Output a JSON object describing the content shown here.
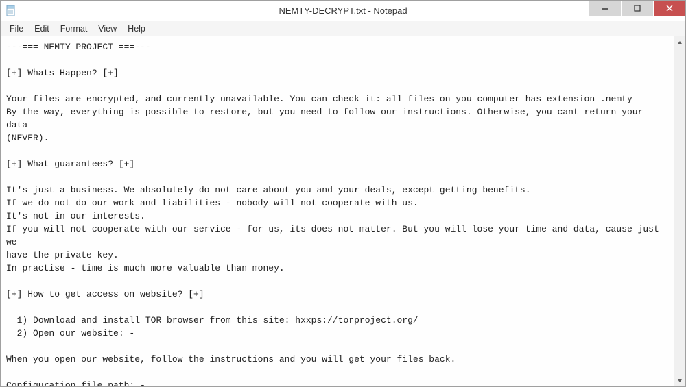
{
  "window": {
    "title": "NEMTY-DECRYPT.txt - Notepad"
  },
  "menubar": {
    "items": [
      "File",
      "Edit",
      "Format",
      "View",
      "Help"
    ]
  },
  "content": {
    "text": "---=== NEMTY PROJECT ===---\n\n[+] Whats Happen? [+]\n\nYour files are encrypted, and currently unavailable. You can check it: all files on you computer has extension .nemty\nBy the way, everything is possible to restore, but you need to follow our instructions. Otherwise, you cant return your data\n(NEVER).\n\n[+] What guarantees? [+]\n\nIt's just a business. We absolutely do not care about you and your deals, except getting benefits.\nIf we do not do our work and liabilities - nobody will not cooperate with us.\nIt's not in our interests.\nIf you will not cooperate with our service - for us, its does not matter. But you will lose your time and data, cause just we\nhave the private key.\nIn practise - time is much more valuable than money.\n\n[+] How to get access on website? [+]\n\n  1) Download and install TOR browser from this site: hxxps://torproject.org/\n  2) Open our website: -\n\nWhen you open our website, follow the instructions and you will get your files back.\n\nConfiguration file path: -"
  }
}
